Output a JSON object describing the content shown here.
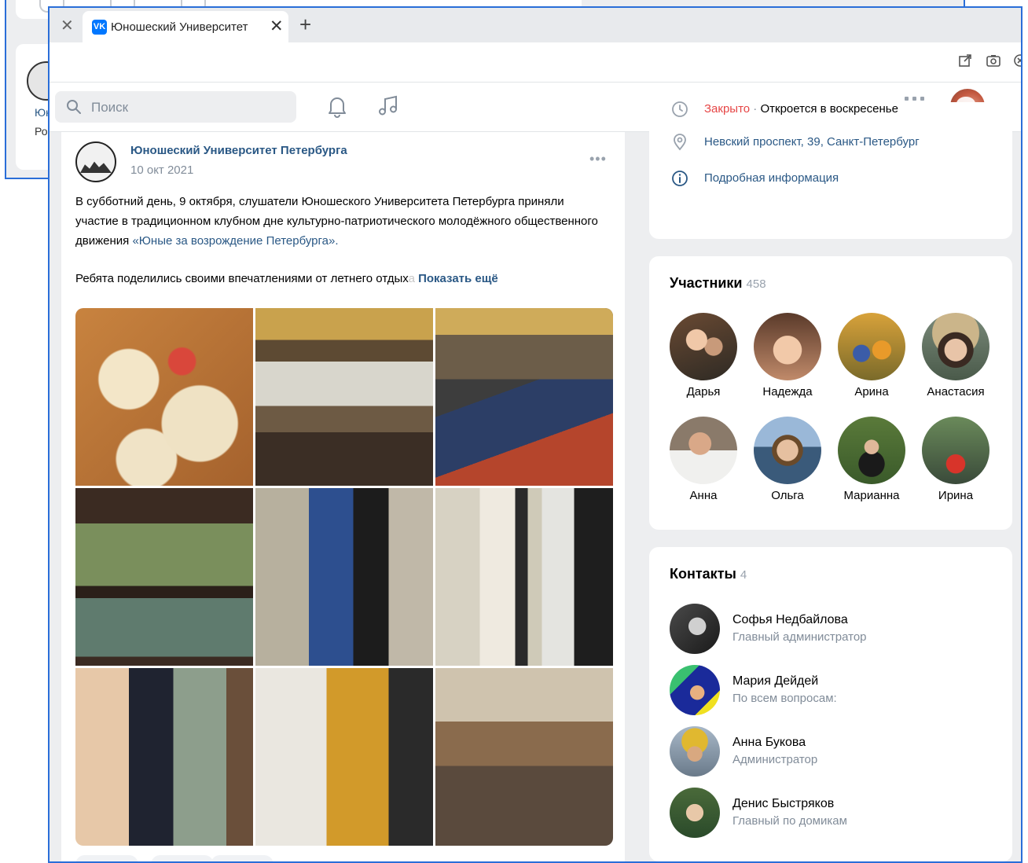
{
  "background_window": {
    "name_fragment": "Юн",
    "line_fragment": "Ро"
  },
  "browser": {
    "tab_title": "Юношеский Университет",
    "favicon_text": "VK",
    "accent": "#2a6ed8"
  },
  "header": {
    "search_placeholder": "Поиск"
  },
  "post": {
    "author": "Юношеский Университет Петербурга",
    "date": "10 окт 2021",
    "more": "•••",
    "text_main": "В субботний день, 9 октября, слушатели Юношеского Университета Петербурга приняли участие в традиционном клубном дне культурно-патриотического молодёжного общественного движения ",
    "text_link": "«Юные за возрождение Петербурга».",
    "text_second": "Ребята поделились своими впечатлениями от летнего отдых",
    "text_fade": "а",
    "show_more": "Показать ещё"
  },
  "info": {
    "status_closed": "Закрыто",
    "status_sep": " · ",
    "status_open": "Откроется в воскресенье",
    "address": "Невский проспект, 39, Санкт-Петербург",
    "details": "Подробная информация",
    "closed_color": "#e64646",
    "link_color": "#2a5885"
  },
  "members": {
    "title": "Участники",
    "count": "458",
    "items": [
      {
        "name": "Дарья"
      },
      {
        "name": "Надежда"
      },
      {
        "name": "Арина"
      },
      {
        "name": "Анастасия"
      },
      {
        "name": "Анна"
      },
      {
        "name": "Ольга"
      },
      {
        "name": "Марианна"
      },
      {
        "name": "Ирина"
      }
    ]
  },
  "contacts": {
    "title": "Контакты",
    "count": "4",
    "items": [
      {
        "name": "Софья Недбайлова",
        "role": "Главный администратор"
      },
      {
        "name": "Мария Дейдей",
        "role": "По всем вопросам:"
      },
      {
        "name": "Анна Букова",
        "role": "Администратор"
      },
      {
        "name": "Денис Быстряков",
        "role": "Главный по домикам"
      }
    ]
  },
  "icons": [
    "close-icon",
    "vk-favicon-icon",
    "new-tab-icon",
    "share-icon",
    "screenshot-icon",
    "search-icon",
    "bell-icon",
    "music-icon",
    "apps-grid-icon",
    "chevron-down-icon",
    "clock-icon",
    "location-pin-icon",
    "info-icon",
    "more-icon"
  ]
}
